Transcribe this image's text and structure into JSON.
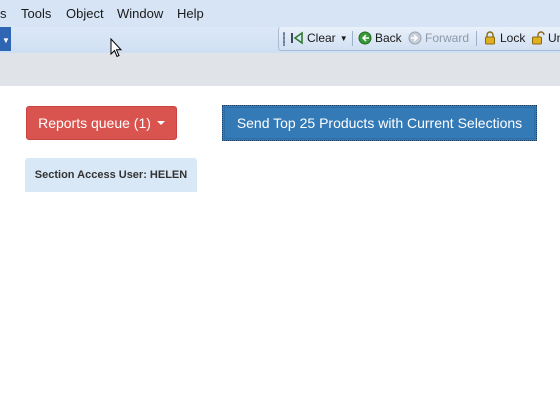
{
  "menubar": {
    "items": [
      "s",
      "Tools",
      "Object",
      "Window",
      "Help"
    ]
  },
  "toolbar": {
    "clear_label": "Clear",
    "back_label": "Back",
    "forward_label": "Forward",
    "lock_label": "Lock",
    "unlock_label": "Un"
  },
  "main": {
    "reports_queue_label": "Reports queue (1)",
    "send_button_label": "Send Top 25 Products with Current Selections",
    "section_access_label": "Section Access User: HELEN"
  },
  "colors": {
    "reports_button": "#d9534f",
    "send_button": "#337ab7",
    "section_access_bg": "#d9e8f6"
  }
}
